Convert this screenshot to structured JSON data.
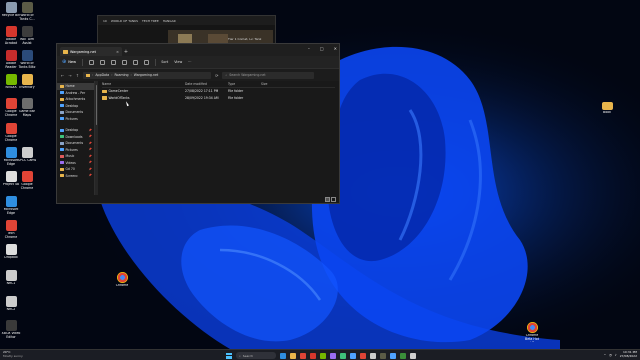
{
  "desktop": {
    "icons_left": [
      {
        "label": "Recycle Bin",
        "color": "#8a9bb0"
      },
      {
        "label": "World of Tanks C...",
        "color": "#5b5b46"
      },
      {
        "label": "Adobe Acrobat",
        "color": "#d6372d"
      },
      {
        "label": "WoT Aim Assist",
        "color": "#3c3c3c"
      },
      {
        "label": "Adobe Reader",
        "color": "#c62c2c"
      },
      {
        "label": "World of Tanks Blitz",
        "color": "#2b4b7a"
      },
      {
        "label": "NVIDIA",
        "color": "#76b900"
      },
      {
        "label": "Inventory",
        "color": "#e8b54c"
      },
      {
        "label": "Google Chrome",
        "color": "#e04436"
      },
      {
        "label": "Game Bar Maps",
        "color": "#6d6d6d"
      },
      {
        "label": "Google Chrome",
        "color": "#e04436"
      },
      {
        "label": "Microsoft Edge",
        "color": "#2f8ee0"
      },
      {
        "label": "Project 48",
        "color": "#dddddd"
      },
      {
        "label": "SPCC Cams",
        "color": "#cccccc"
      },
      {
        "label": "Microsoft Edge",
        "color": "#2f8ee0"
      },
      {
        "label": "Google Chrome",
        "color": "#e04436"
      },
      {
        "label": "Tech Chrome",
        "color": "#e04436"
      },
      {
        "label": "Dropbox",
        "color": "#dddddd"
      },
      {
        "label": "NRC1",
        "color": "#cccccc"
      },
      {
        "label": "NRC2",
        "color": "#cccccc"
      },
      {
        "label": "XBOX Video Editor",
        "color": "#3a3a3a"
      }
    ],
    "icon_mid": {
      "label": "Chrome",
      "color": "#e04436"
    },
    "icon_right_top": {
      "label": "Book",
      "color": "#e8b54c"
    },
    "icon_right_bottom": {
      "label": "Chrome Beta Hot and Pa...",
      "color": "#e04436"
    }
  },
  "game_window": {
    "items": [
      "10",
      "WORLD OF TANKS",
      "TECH TREE",
      "HANGAR"
    ],
    "label": "Tier 1 Comet, Lv: Tank"
  },
  "explorer": {
    "tab_title": "Wargaming.net",
    "new_label": "New",
    "sort_label": "Sort",
    "view_label": "View",
    "more_label": "···",
    "address": [
      "AppData",
      "Roaming",
      "Wargaming.net"
    ],
    "search_placeholder": "Search Wargaming.net",
    "nav_items": [
      {
        "label": "Home",
        "color": "#e8b54c",
        "selected": true
      },
      {
        "label": "Andrew - Per",
        "color": "#4fa3ff"
      },
      {
        "label": "Attachments",
        "color": "#e8b54c"
      },
      {
        "label": "Desktop",
        "color": "#4fa3ff"
      },
      {
        "label": "Documents",
        "color": "#8aa4c8"
      },
      {
        "label": "Pictures",
        "color": "#4fa3ff"
      },
      {
        "label": "",
        "gap": true
      },
      {
        "label": "Desktop",
        "color": "#4fa3ff",
        "pin": "📌"
      },
      {
        "label": "Downloads",
        "color": "#3fc17a",
        "pin": "📌"
      },
      {
        "label": "Documents",
        "color": "#8aa4c8",
        "pin": "📌"
      },
      {
        "label": "Pictures",
        "color": "#4fa3ff",
        "pin": "📌"
      },
      {
        "label": "Music",
        "color": "#e05a5a",
        "pin": "📌"
      },
      {
        "label": "Videos",
        "color": "#9a6cf0",
        "pin": "📌"
      },
      {
        "label": "Gd 70",
        "color": "#e8b54c",
        "pin": "📌"
      },
      {
        "label": "Screenc",
        "color": "#e8b54c",
        "pin": "📌"
      }
    ],
    "columns": {
      "name": "Name",
      "date": "Date modified",
      "type": "Type",
      "size": "Size"
    },
    "rows": [
      {
        "name": "GameCenter",
        "date": "27/08/2022 17:11 PM",
        "type": "File folder",
        "size": ""
      },
      {
        "name": "WorldOfTanks",
        "date": "28/09/2022 19:34 AM",
        "type": "File folder",
        "size": ""
      }
    ]
  },
  "taskbar": {
    "weather_temp": "20°C",
    "weather_desc": "Mostly sunny",
    "search_label": "Search",
    "apps": [
      "#2f8ee0",
      "#e8b54c",
      "#e04436",
      "#d6372d",
      "#76b900",
      "#9a6cf0",
      "#3fc17a",
      "#4fa3ff",
      "#e04436",
      "#cccccc",
      "#5b5b46",
      "#4fa3ff",
      "#3a8f3a",
      "#d0d0d0"
    ],
    "time": "10:31 PM",
    "date": "27/08/2022"
  }
}
